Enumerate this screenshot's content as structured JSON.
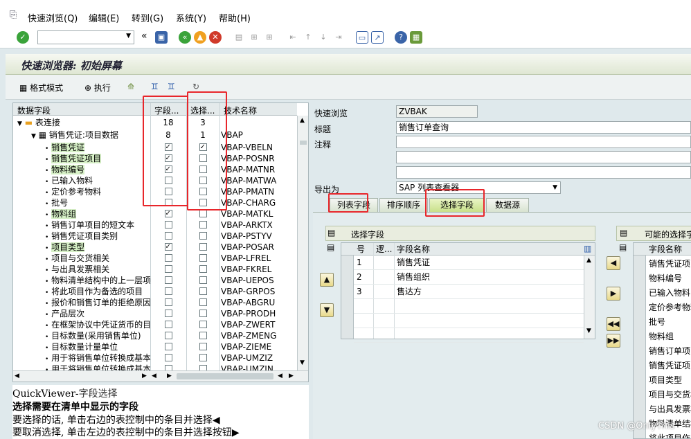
{
  "menu": [
    "快速浏览(Q)",
    "编辑(E)",
    "转到(G)",
    "系统(Y)",
    "帮助(H)"
  ],
  "screen_title": "快速浏览器: 初始屏幕",
  "app_toolbar": {
    "layout_mode": "格式模式",
    "execute": "执行"
  },
  "tree": {
    "headers": {
      "field": "数据字段",
      "list_field": "字段...",
      "sel_field": "选择...",
      "tech_name": "技术名称"
    },
    "join_label": "表连接",
    "join_count1": "18",
    "join_count2": "3",
    "table_label": "销售凭证:项目数据",
    "table_count1": "8",
    "table_count2": "1",
    "table_tech": "VBAP",
    "rows": [
      {
        "label": "销售凭证",
        "tech": "VBAP-VBELN",
        "c1": true,
        "c2": true,
        "hl": true
      },
      {
        "label": "销售凭证项目",
        "tech": "VBAP-POSNR",
        "c1": true,
        "c2": false,
        "hl": true
      },
      {
        "label": "物料编号",
        "tech": "VBAP-MATNR",
        "c1": true,
        "c2": false,
        "hl": true
      },
      {
        "label": "已输入物料",
        "tech": "VBAP-MATWA",
        "c1": false,
        "c2": false,
        "hl": false
      },
      {
        "label": "定价参考物料",
        "tech": "VBAP-PMATN",
        "c1": false,
        "c2": false,
        "hl": false
      },
      {
        "label": "批号",
        "tech": "VBAP-CHARG",
        "c1": false,
        "c2": false,
        "hl": false
      },
      {
        "label": "物料组",
        "tech": "VBAP-MATKL",
        "c1": true,
        "c2": false,
        "hl": true
      },
      {
        "label": "销售订单项目的短文本",
        "tech": "VBAP-ARKTX",
        "c1": false,
        "c2": false,
        "hl": false
      },
      {
        "label": "销售凭证项目类别",
        "tech": "VBAP-PSTYV",
        "c1": false,
        "c2": false,
        "hl": false
      },
      {
        "label": "项目类型",
        "tech": "VBAP-POSAR",
        "c1": true,
        "c2": false,
        "hl": true
      },
      {
        "label": "项目与交货相关",
        "tech": "VBAP-LFREL",
        "c1": false,
        "c2": false,
        "hl": false
      },
      {
        "label": "与出具发票相关",
        "tech": "VBAP-FKREL",
        "c1": false,
        "c2": false,
        "hl": false
      },
      {
        "label": "物料清单结构中的上一层项目",
        "tech": "VBAP-UEPOS",
        "c1": false,
        "c2": false,
        "hl": false
      },
      {
        "label": "将此项目作为备选的项目",
        "tech": "VBAP-GRPOS",
        "c1": false,
        "c2": false,
        "hl": false
      },
      {
        "label": "报价和销售订单的拒绝原因",
        "tech": "VBAP-ABGRU",
        "c1": false,
        "c2": false,
        "hl": false
      },
      {
        "label": "产品层次",
        "tech": "VBAP-PRODH",
        "c1": false,
        "c2": false,
        "hl": false
      },
      {
        "label": "在框架协议中凭证货币的目标值",
        "tech": "VBAP-ZWERT",
        "c1": false,
        "c2": false,
        "hl": false
      },
      {
        "label": "目标数量(采用销售单位)",
        "tech": "VBAP-ZMENG",
        "c1": false,
        "c2": false,
        "hl": false
      },
      {
        "label": "目标数量计量单位",
        "tech": "VBAP-ZIEME",
        "c1": false,
        "c2": false,
        "hl": false
      },
      {
        "label": "用于将销售单位转换成基本单位",
        "tech": "VBAP-UMZIZ",
        "c1": false,
        "c2": false,
        "hl": false
      },
      {
        "label": "用于将销售单位转换成基本单位",
        "tech": "VBAP-UMZIN",
        "c1": false,
        "c2": false,
        "hl": false
      }
    ]
  },
  "help": {
    "title_a": "QuickViewer-",
    "title_b": "字段选择",
    "heading": "选择需要在清单中显示的字段",
    "line1": "要选择的话, 单击右边的表控制中的条目并选择",
    "line2": "要取消选择, 单击左边的表控制中的条目并选择按钮"
  },
  "form": {
    "qv_label": "快速浏览",
    "qv_value": "ZVBAK",
    "title_label": "标题",
    "title_value": "销售订单查询",
    "note_label": "注释",
    "export_label": "导出为",
    "export_value": "SAP 列表查看器"
  },
  "tabs": [
    "列表字段",
    "排序顺序",
    "选择字段",
    "数据源"
  ],
  "selected_grid": {
    "title": "选择字段",
    "headers": {
      "no": "号",
      "logic": "逻...",
      "name": "字段名称"
    },
    "rows": [
      {
        "no": "1",
        "name": "销售凭证"
      },
      {
        "no": "2",
        "name": "销售组织"
      },
      {
        "no": "3",
        "name": "售达方"
      }
    ]
  },
  "possible_grid": {
    "title": "可能的选择字段",
    "header": "字段名称",
    "rows": [
      "销售凭证项目",
      "物料编号",
      "已输入物料",
      "定价参考物料",
      "批号",
      "物料组",
      "销售订单项目的短文本",
      "销售凭证项目类别",
      "项目类型",
      "项目与交货相关",
      "与出具发票相关",
      "物料清单结构中的上一层项目",
      "将此项目作为备选的项目"
    ]
  },
  "watermark": "CSDN @OnlyThis",
  "colors": {
    "highlight_box": "#e8262b",
    "field_highlight": "#d6f0c6",
    "active_tab": "#c8e08a"
  }
}
